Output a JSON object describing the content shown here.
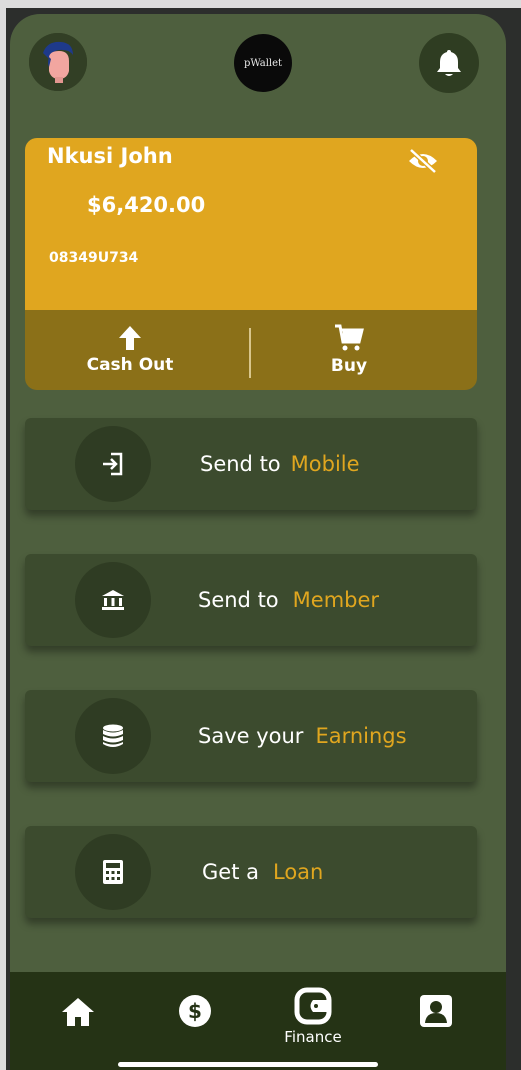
{
  "app": {
    "logo_text": "pWallet"
  },
  "card": {
    "name": "Nkusi John",
    "balance": "$6,420.00",
    "account_number": "08349U734",
    "actions": [
      {
        "label": "Cash Out",
        "icon": "arrow-up-icon"
      },
      {
        "label": "Buy",
        "icon": "cart-icon"
      }
    ]
  },
  "services": [
    {
      "main": "Send to",
      "accent": "Mobile",
      "icon": "login-icon"
    },
    {
      "main": "Send to",
      "accent": "Member",
      "icon": "bank-icon"
    },
    {
      "main": "Save your",
      "accent": "Earnings",
      "icon": "database-icon"
    },
    {
      "main": "Get a",
      "accent": "Loan",
      "icon": "calculator-icon"
    }
  ],
  "bottom_nav": [
    {
      "label": "",
      "icon": "home-icon"
    },
    {
      "label": "",
      "icon": "dollar-icon"
    },
    {
      "label": "Finance",
      "icon": "wallet-icon",
      "active": true
    },
    {
      "label": "",
      "icon": "contact-icon"
    }
  ],
  "colors": {
    "background": "#4e5f3e",
    "accent": "#e0a61f",
    "card_footer": "#8b7018",
    "item_bg": "#3c4b2e",
    "nav_bg": "#253315"
  }
}
